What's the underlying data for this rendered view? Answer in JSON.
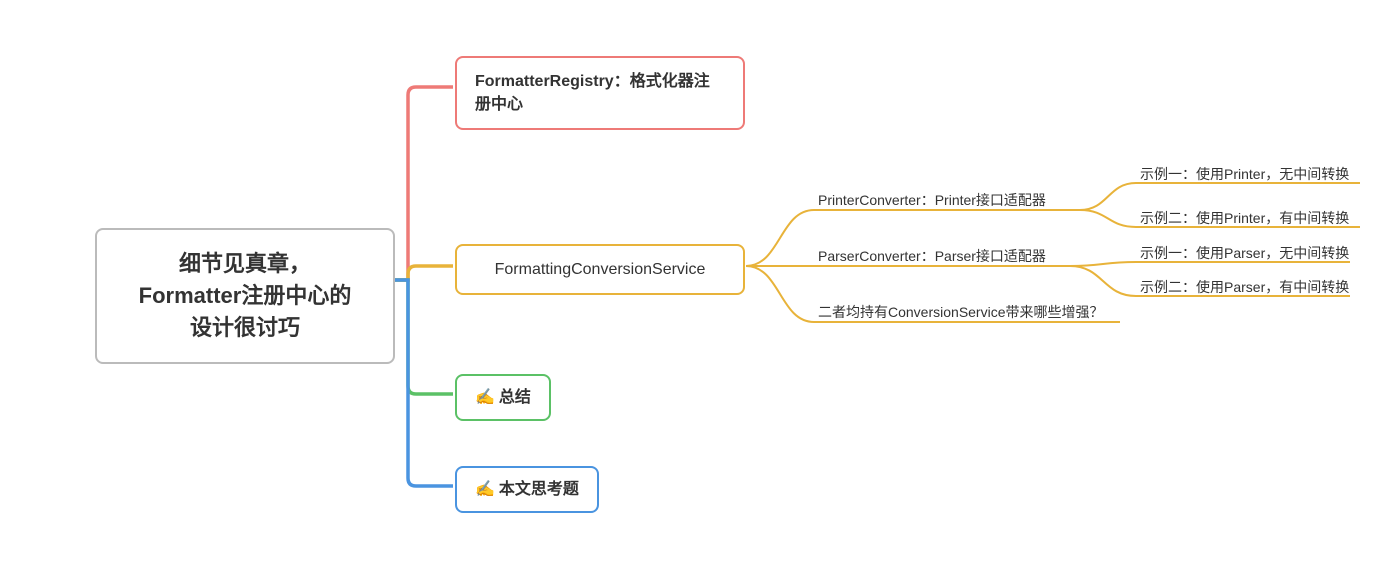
{
  "root": {
    "line1": "细节见真章，",
    "line2": "Formatter注册中心的",
    "line3": "设计很讨巧"
  },
  "branches": {
    "registry": "FormatterRegistry：格式化器注册中心",
    "service": "FormattingConversionService",
    "summary": "总结",
    "questions": "本文思考题"
  },
  "icons": {
    "pencil": "✍"
  },
  "mids": {
    "printer": "PrinterConverter：Printer接口适配器",
    "parser": "ParserConverter：Parser接口适配器",
    "enhance": "二者均持有ConversionService带来哪些增强？"
  },
  "leaves": {
    "printer1": "示例一：使用Printer，无中间转换",
    "printer2": "示例二：使用Printer，有中间转换",
    "parser1": "示例一：使用Parser，无中间转换",
    "parser2": "示例二：使用Parser，有中间转换"
  }
}
